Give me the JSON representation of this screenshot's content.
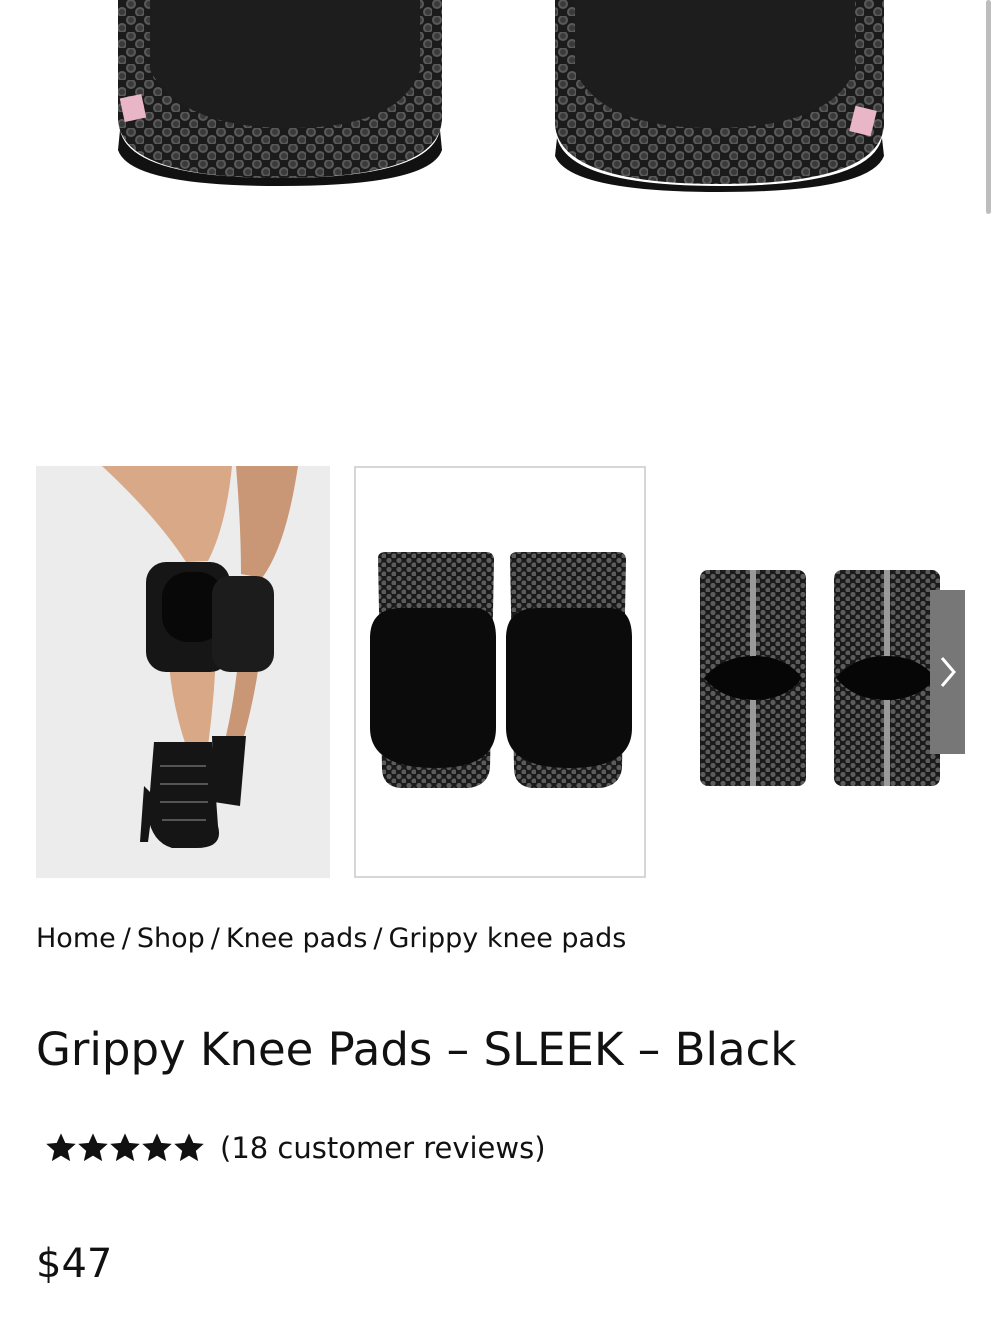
{
  "gallery": {
    "main_image_alt": "Grippy knee pads main product image",
    "thumbnails": [
      {
        "alt": "Model wearing black knee pads with lace-up heels"
      },
      {
        "alt": "Front view of pair of black knee pads"
      },
      {
        "alt": "Back view of pair of black knee pads"
      }
    ],
    "next_icon": "chevron-right-icon"
  },
  "breadcrumb": {
    "items": [
      "Home",
      "Shop",
      "Knee pads",
      "Grippy knee pads"
    ],
    "separator": "/"
  },
  "product": {
    "title": "Grippy Knee Pads – SLEEK – Black",
    "rating": 5,
    "rating_max": 5,
    "reviews_text": "(18 customer reviews)",
    "price": "$47"
  },
  "colors": {
    "text": "#111111",
    "thumb_border": "#d6d6d6",
    "nav_button": "#777777"
  }
}
